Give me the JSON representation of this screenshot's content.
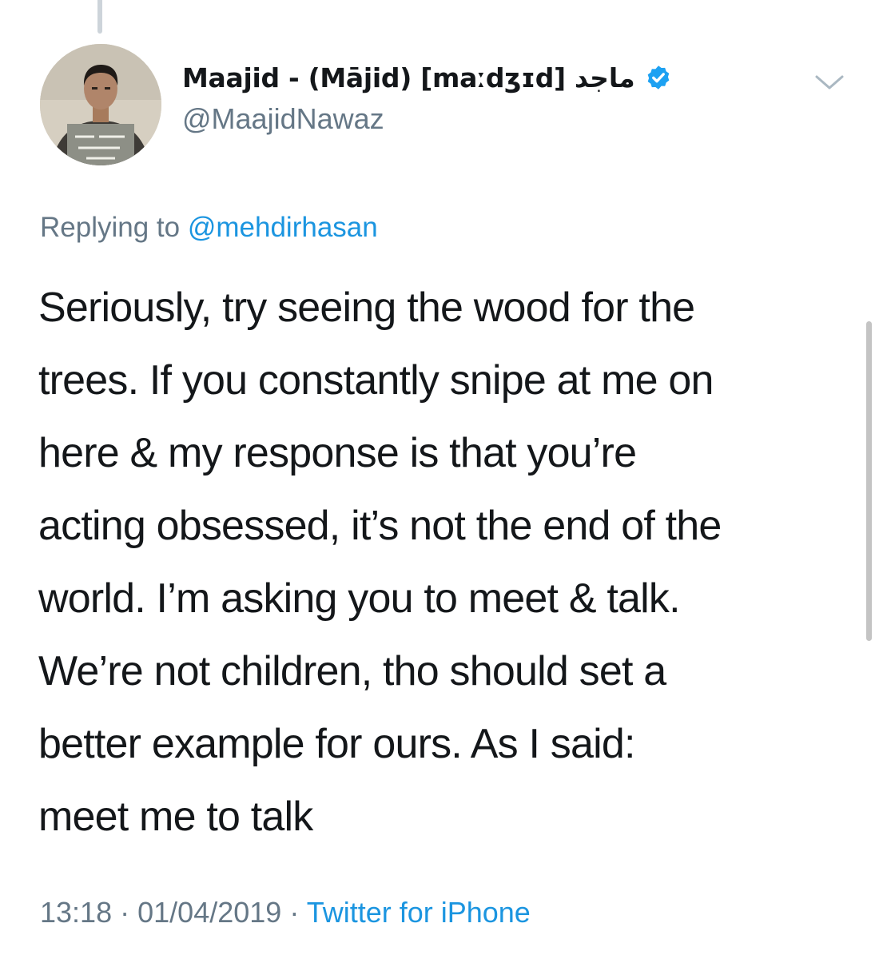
{
  "user": {
    "display_name": "Maajid - (Mājid) [maːdʒɪd] ماجد",
    "handle": "@MaajidNawaz",
    "verified": true
  },
  "icons": {
    "verified": "verified-badge-icon",
    "menu": "chevron-down-icon"
  },
  "reply": {
    "prefix": "Replying to",
    "mention": "@mehdirhasan"
  },
  "tweet": {
    "lines": [
      "Seriously, try seeing the wood for the",
      "trees. If you constantly snipe at me on",
      "here & my response is that you’re",
      "acting obsessed, it’s not the end of the",
      "world. I’m asking you to meet & talk.",
      "We’re not children, tho should set a",
      "better example for ours. As I said:",
      "meet me to talk"
    ]
  },
  "meta": {
    "time": "13:18",
    "separator": "·",
    "date": "01/04/2019",
    "source": "Twitter for iPhone"
  },
  "colors": {
    "text_primary": "#14171a",
    "text_secondary": "#657786",
    "link": "#1b95e0",
    "verified_badge": "#1da1f2"
  }
}
